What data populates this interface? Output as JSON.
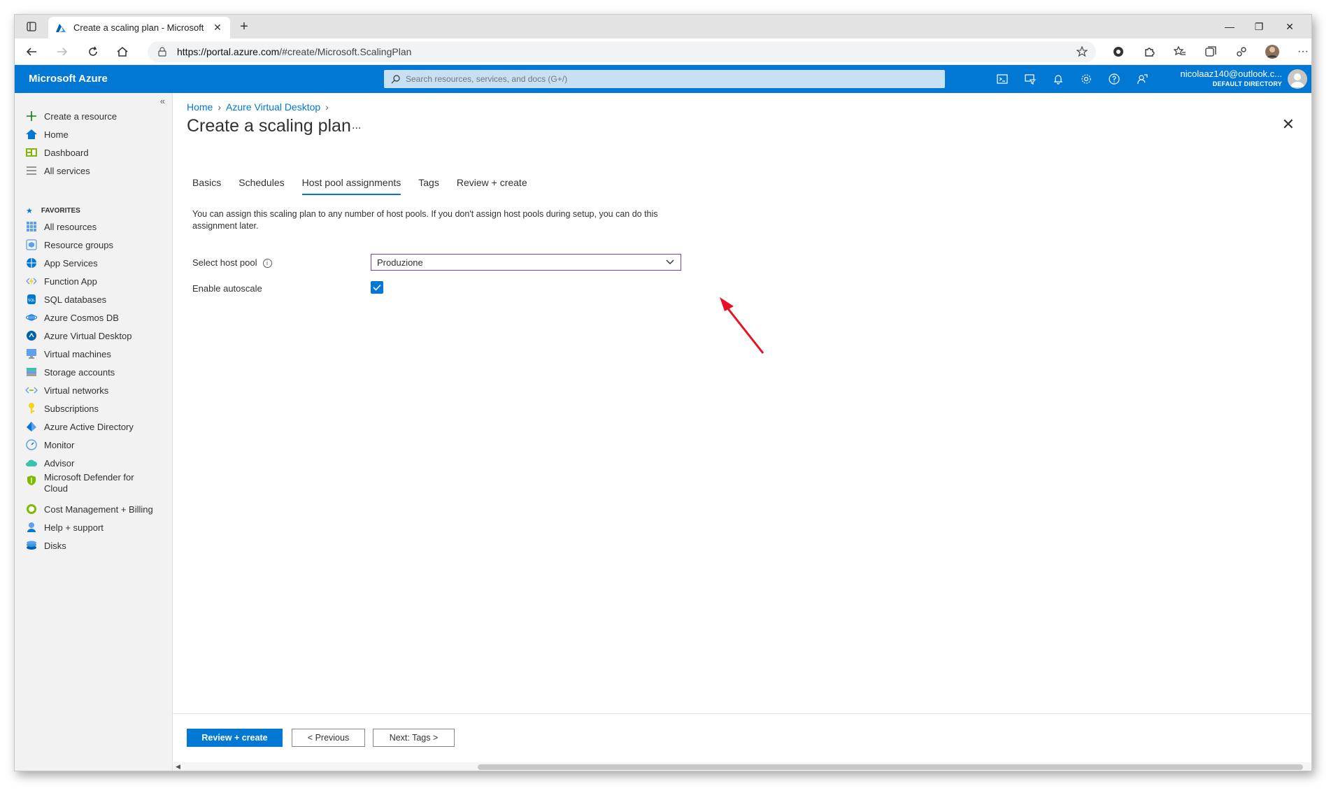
{
  "browser": {
    "tab_title": "Create a scaling plan - Microsoft",
    "url_host": "https://portal.azure.com",
    "url_rest": "/#create/Microsoft.ScalingPlan"
  },
  "azure": {
    "brand": "Microsoft Azure",
    "search_placeholder": "Search resources, services, and docs (G+/)",
    "user_email": "nicolaaz140@outlook.c...",
    "user_directory": "DEFAULT DIRECTORY",
    "accent": "#0078d4"
  },
  "sidebar": {
    "top_items": [
      {
        "label": "Create a resource",
        "icon": "plus-icon"
      },
      {
        "label": "Home",
        "icon": "home-icon"
      },
      {
        "label": "Dashboard",
        "icon": "dashboard-icon"
      },
      {
        "label": "All services",
        "icon": "list-icon"
      }
    ],
    "favorites_label": "FAVORITES",
    "items": [
      {
        "label": "All resources",
        "icon": "grid-icon"
      },
      {
        "label": "Resource groups",
        "icon": "cube-icon"
      },
      {
        "label": "App Services",
        "icon": "globe-icon"
      },
      {
        "label": "Function App",
        "icon": "bolt-icon"
      },
      {
        "label": "SQL databases",
        "icon": "sql-icon"
      },
      {
        "label": "Azure Cosmos DB",
        "icon": "planet-icon"
      },
      {
        "label": "Azure Virtual Desktop",
        "icon": "desktop-icon"
      },
      {
        "label": "Virtual machines",
        "icon": "monitor-icon"
      },
      {
        "label": "Storage accounts",
        "icon": "storage-icon"
      },
      {
        "label": "Virtual networks",
        "icon": "network-icon"
      },
      {
        "label": "Subscriptions",
        "icon": "key-icon"
      },
      {
        "label": "Azure Active Directory",
        "icon": "diamond-icon"
      },
      {
        "label": "Monitor",
        "icon": "gauge-icon"
      },
      {
        "label": "Advisor",
        "icon": "cloud-icon"
      },
      {
        "label": "Microsoft Defender for Cloud",
        "icon": "shield-icon"
      },
      {
        "label": "Cost Management + Billing",
        "icon": "cost-icon"
      },
      {
        "label": "Help + support",
        "icon": "person-icon"
      },
      {
        "label": "Disks",
        "icon": "disk-icon"
      }
    ]
  },
  "page": {
    "breadcrumb": [
      "Home",
      "Azure Virtual Desktop"
    ],
    "title": "Create a scaling plan",
    "more": "...",
    "tabs": [
      "Basics",
      "Schedules",
      "Host pool assignments",
      "Tags",
      "Review + create"
    ],
    "active_tab": "Host pool assignments",
    "description": "You can assign this scaling plan to any number of host pools. If you don't assign host pools during setup, you can do this assignment later.",
    "host_pool_label": "Select host pool",
    "host_pool_value": "Produzione",
    "autoscale_label": "Enable autoscale",
    "autoscale_checked": true
  },
  "footer": {
    "review_create": "Review + create",
    "previous": "< Previous",
    "next": "Next: Tags >"
  }
}
